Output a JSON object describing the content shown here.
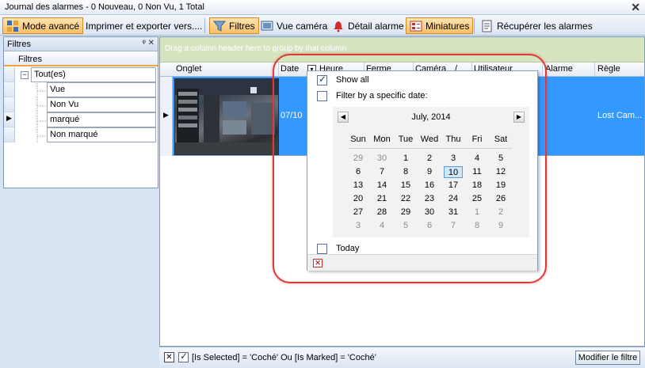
{
  "window": {
    "title": "Journal des alarmes - 0 Nouveau, 0 Non Vu, 1 Total",
    "close_glyph": "✕"
  },
  "toolbar": {
    "mode_avance": "Mode avancé",
    "imprimer": "Imprimer et exporter vers....",
    "filtres": "Filtres",
    "vue_camera": "Vue caméra",
    "detail_alarme": "Détail alarme",
    "miniatures": "Miniatures",
    "recuperer": "Récupérer les alarmes"
  },
  "filters_panel": {
    "title": "Filtres",
    "pin_close": "ᵠ ✕",
    "column_header": "Filtres",
    "tree": {
      "root_toggle": "−",
      "root": "Tout(es)",
      "children": [
        "Vue",
        "Non Vu",
        "marqué",
        "Non marqué"
      ]
    },
    "current_row_marker": "▶"
  },
  "grid": {
    "group_hint": "Drag a column header here to group by that column",
    "columns": [
      "Onglet",
      "Date",
      "Heure",
      "Ferme",
      "Caméra",
      "/",
      "Utilisateur",
      "Alarme",
      "Règle"
    ],
    "row": {
      "marker": "▶",
      "date": "07/10",
      "regle": "Lost Cam..."
    }
  },
  "footer": {
    "clear_glyph": "✕",
    "filter_expression": "[Is Selected] = 'Coché' Ou [Is Marked] = 'Coché'",
    "modify_button": "Modifier le filtre"
  },
  "date_filter_popup": {
    "show_all_label": "Show all",
    "show_all_checked": true,
    "specific_date_label": "Filter by a specific date:",
    "specific_date_checked": false,
    "today_label": "Today",
    "today_checked": false,
    "close_glyph": "✕",
    "calendar": {
      "month_label": "July, 2014",
      "prev": "◀",
      "next": "▶",
      "weekdays": [
        "Sun",
        "Mon",
        "Tue",
        "Wed",
        "Thu",
        "Fri",
        "Sat"
      ],
      "weeks": [
        [
          "29",
          "30",
          "1",
          "2",
          "3",
          "4",
          "5"
        ],
        [
          "6",
          "7",
          "8",
          "9",
          "10",
          "11",
          "12"
        ],
        [
          "13",
          "14",
          "15",
          "16",
          "17",
          "18",
          "19"
        ],
        [
          "20",
          "21",
          "22",
          "23",
          "24",
          "25",
          "26"
        ],
        [
          "27",
          "28",
          "29",
          "30",
          "31",
          "1",
          "2"
        ],
        [
          "3",
          "4",
          "5",
          "6",
          "7",
          "8",
          "9"
        ]
      ],
      "selected_day": "10"
    }
  },
  "colors": {
    "row_selected": "#3399ff",
    "active_button": "#f9bf66",
    "highlight_ring": "#dd3a3a"
  }
}
